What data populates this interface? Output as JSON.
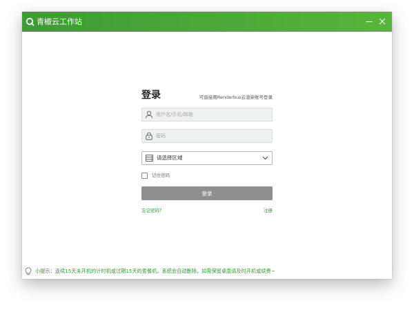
{
  "window": {
    "title": "青椒云工作站",
    "minimize_icon": "minimize-icon",
    "close_icon": "close-icon",
    "accent_color": "#4aa93a"
  },
  "login": {
    "title": "登录",
    "renderbus_hint": "可直接用Renderbus云渲染账号登录",
    "username_placeholder": "用户名/手机/邮箱",
    "password_placeholder": "密码",
    "region_placeholder": "请选择区域",
    "remember_label": "记住密码",
    "remember_checked": false,
    "login_button": "登录",
    "forgot_password": "忘记密码？",
    "register": "注册"
  },
  "footer": {
    "tip": "小提示：连续15天未开机的计时机或过期15天的套餐机，系统会自动删除，如需保留桌面请及时开机或续费~"
  }
}
